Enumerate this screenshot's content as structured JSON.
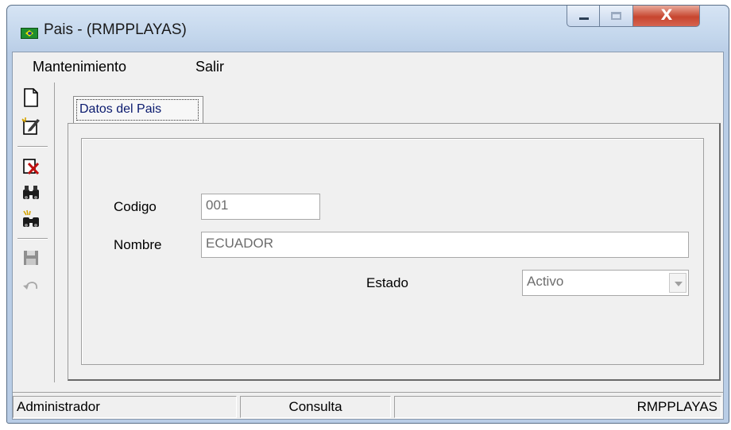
{
  "window": {
    "title": "Pais - (RMPPLAYAS)",
    "close_glyph": "X",
    "title_icon": "brazil-flag-icon"
  },
  "menu": {
    "items": [
      {
        "label": "Mantenimiento"
      },
      {
        "label": "Salir"
      }
    ]
  },
  "toolbar": {
    "icons": [
      "new-document-icon",
      "edit-icon",
      "delete-icon",
      "search-binoculars-icon",
      "advanced-search-icon",
      "save-icon",
      "undo-icon"
    ]
  },
  "tabs": [
    {
      "label": "Datos del Pais",
      "active": true
    }
  ],
  "form": {
    "codigo": {
      "label": "Codigo",
      "value": "001"
    },
    "nombre": {
      "label": "Nombre",
      "value": "ECUADOR"
    },
    "estado": {
      "label": "Estado",
      "value": "Activo"
    }
  },
  "statusbar": {
    "user": "Administrador",
    "mode": "Consulta",
    "company": "RMPPLAYAS"
  },
  "colors": {
    "titlebar": "#c3d6ec",
    "close_button": "#c7452f",
    "tab_label": "#0a1a6e",
    "field_text": "#6d6d6d"
  }
}
